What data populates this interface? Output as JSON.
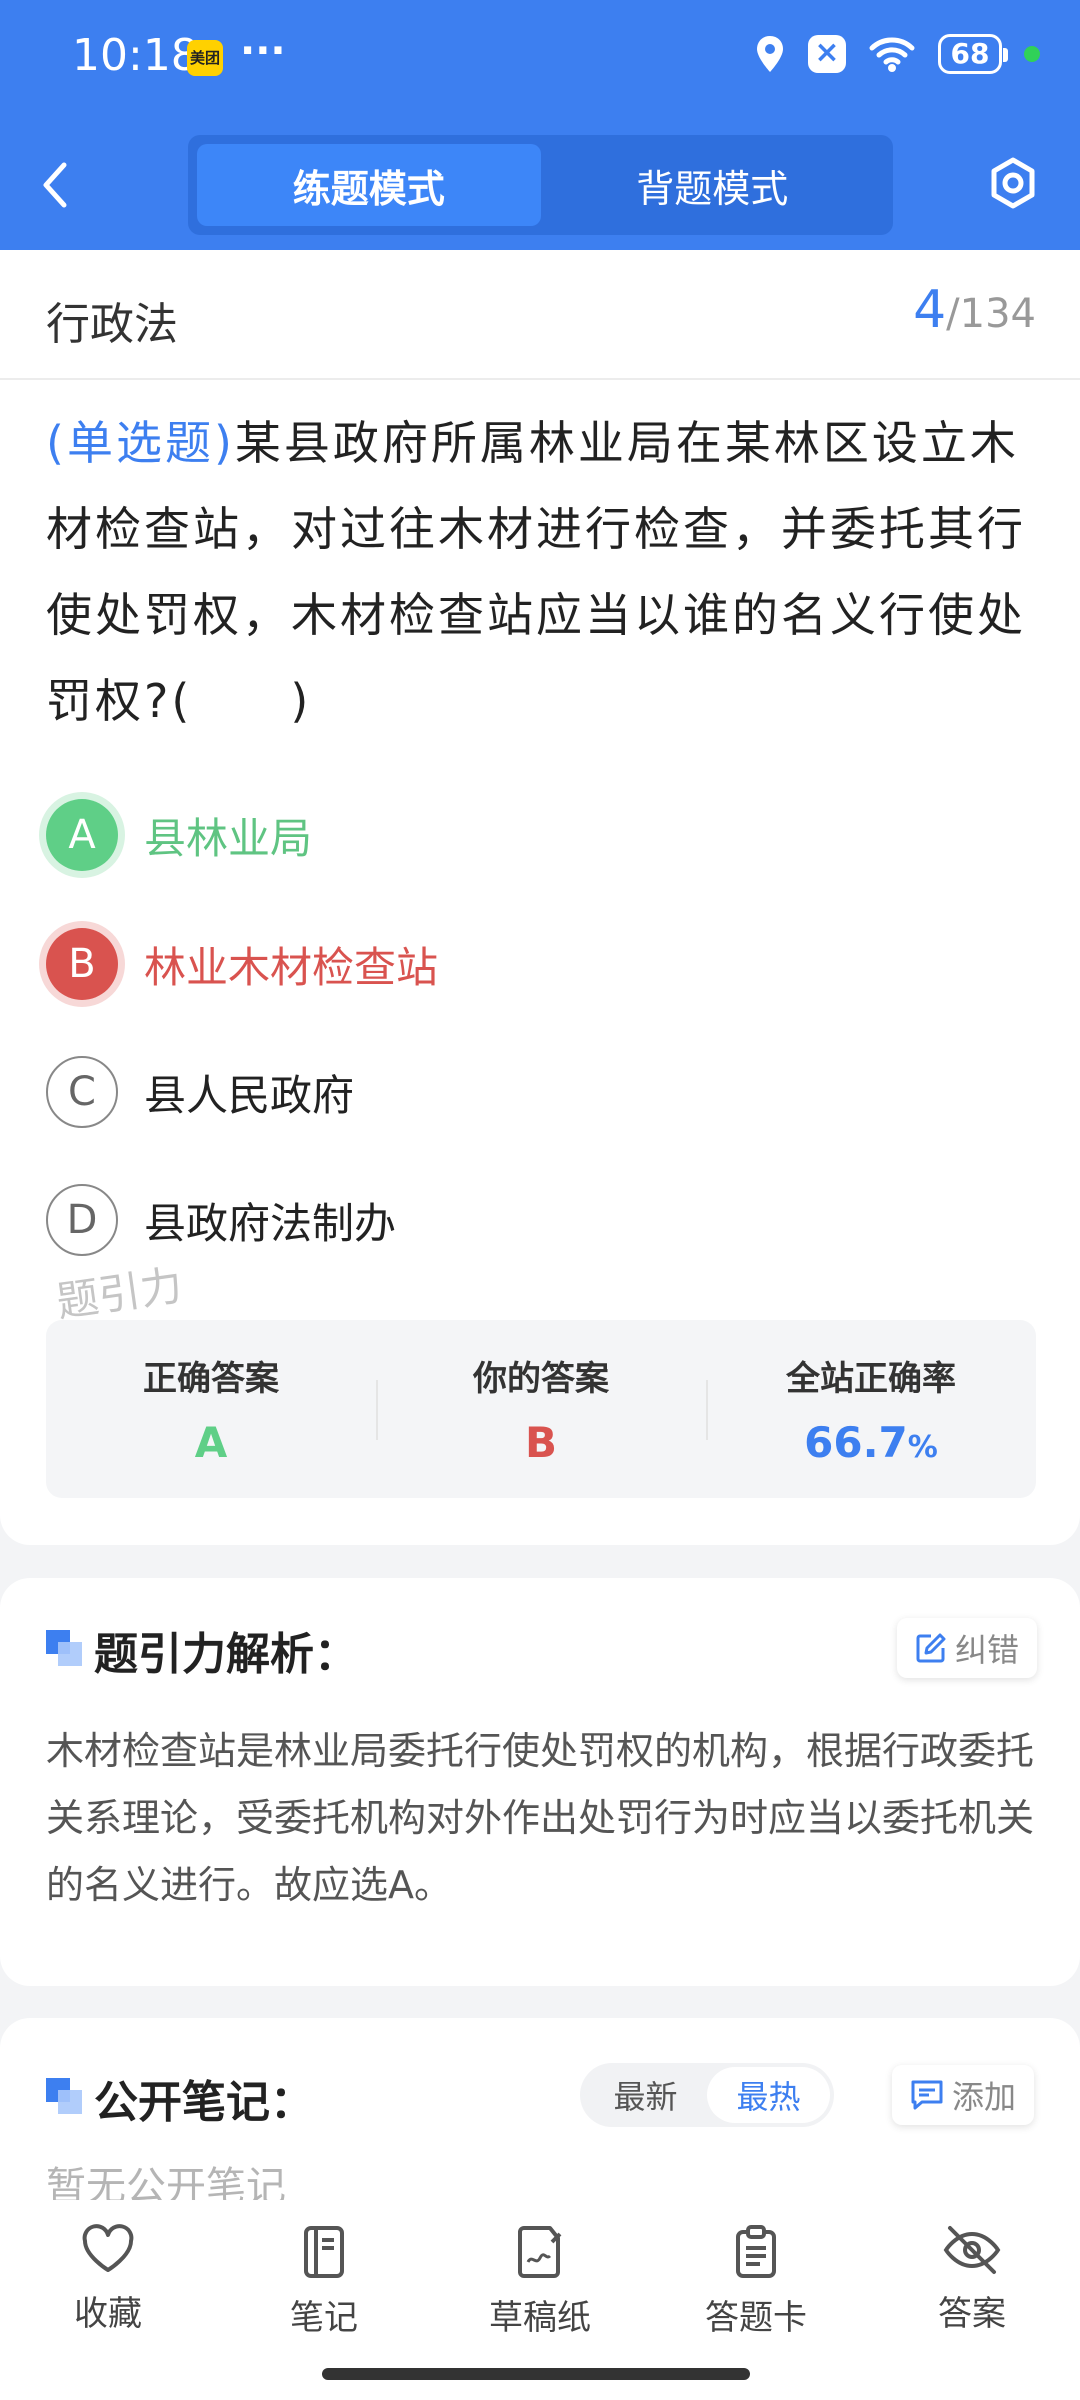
{
  "status_bar": {
    "time": "10:18",
    "app_badge": "美团",
    "more": "···",
    "battery": "68"
  },
  "header": {
    "tabs": [
      {
        "label": "练题模式",
        "active": true
      },
      {
        "label": "背题模式",
        "active": false
      }
    ]
  },
  "question_card": {
    "subject": "行政法",
    "current": "4",
    "total": "/134",
    "type_tag": "(单选题)",
    "question_text": "某县政府所属林业局在某林区设立木材检查站，对过往木材进行检查，并委托其行使处罚权，木材检查站应当以谁的名义行使处罚权?(　　)",
    "options": [
      {
        "letter": "A",
        "text": "县林业局",
        "state": "correct"
      },
      {
        "letter": "B",
        "text": "林业木材检查站",
        "state": "wrong"
      },
      {
        "letter": "C",
        "text": "县人民政府",
        "state": "normal"
      },
      {
        "letter": "D",
        "text": "县政府法制办",
        "state": "normal"
      }
    ],
    "watermark": "题引力",
    "stats": {
      "correct_label": "正确答案",
      "correct_value": "A",
      "your_label": "你的答案",
      "your_value": "B",
      "rate_label": "全站正确率",
      "rate_value": "66.7",
      "rate_unit": "%"
    }
  },
  "explanation": {
    "title": "题引力解析：",
    "correct_btn": "纠错",
    "text": "木材检查站是林业局委托行使处罚权的机构，根据行政委托关系理论，受委托机构对外作出处罚行为时应当以委托机关的名义进行。故应选A。"
  },
  "notes": {
    "title": "公开笔记：",
    "sort_options": [
      "最新",
      "最热"
    ],
    "sort_active": "最热",
    "add_btn": "添加",
    "empty_text": "暂无公开笔记"
  },
  "bottom_bar": {
    "items": [
      {
        "label": "收藏",
        "icon": "heart-icon"
      },
      {
        "label": "笔记",
        "icon": "notebook-icon"
      },
      {
        "label": "草稿纸",
        "icon": "draft-icon"
      },
      {
        "label": "答题卡",
        "icon": "answer-sheet-icon"
      },
      {
        "label": "答案",
        "icon": "eye-off-icon"
      }
    ]
  },
  "colors": {
    "primary": "#3d7ff0",
    "correct": "#5fcf87",
    "wrong": "#d9534f"
  }
}
